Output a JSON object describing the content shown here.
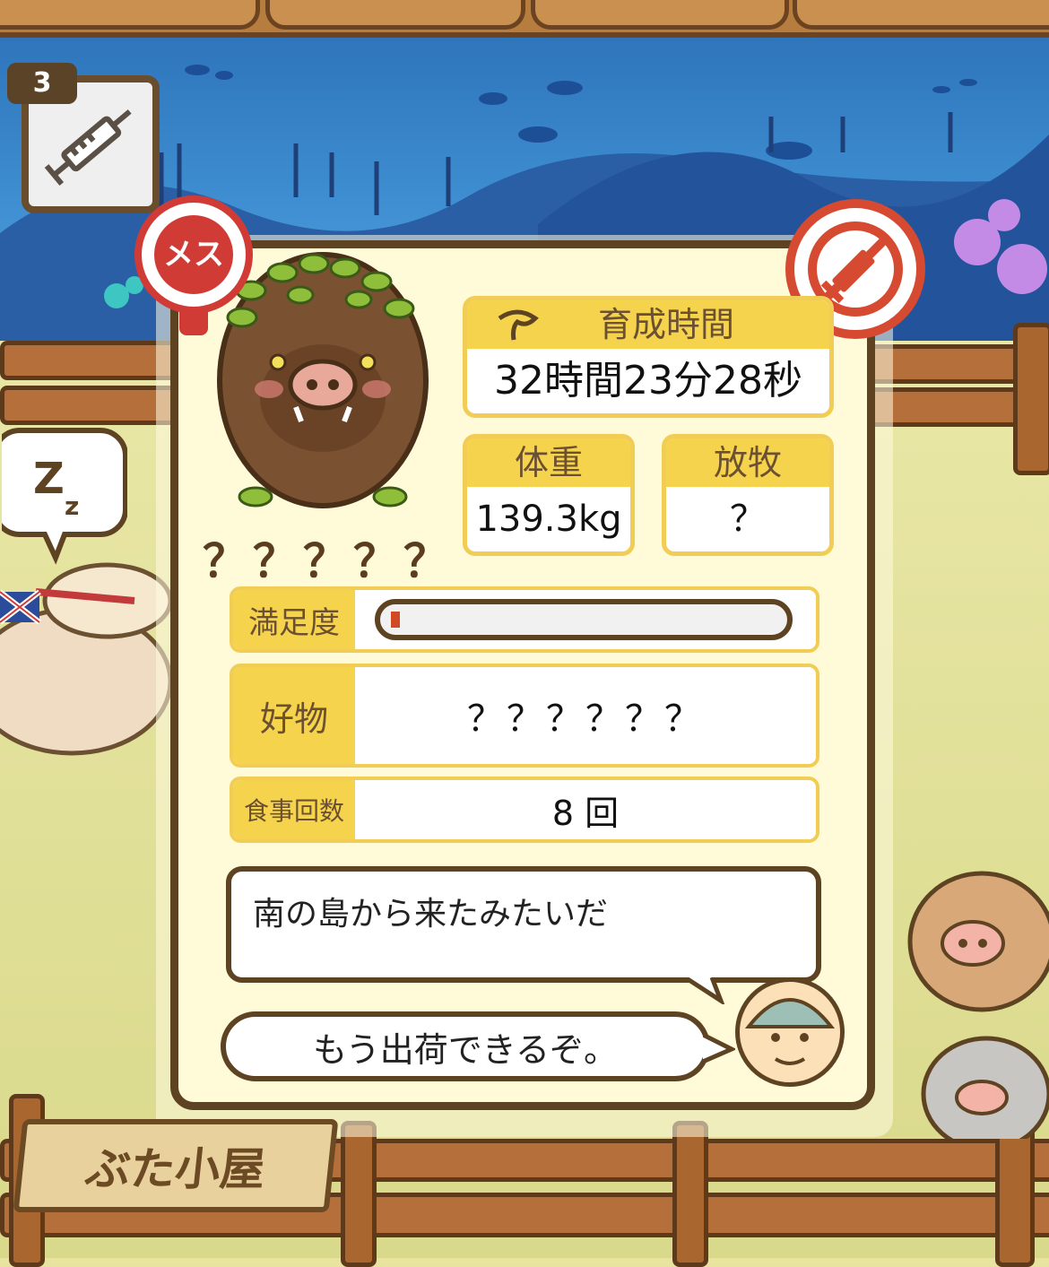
{
  "item": {
    "count": "3",
    "icon": "syringe-icon"
  },
  "pig": {
    "gender_label": "メス",
    "name": "？？？？？",
    "icon": "wild-boar-icon"
  },
  "stats": {
    "raising_time_label": "育成時間",
    "raising_time_value": "32時間23分28秒",
    "weight_label": "体重",
    "weight_value": "139.3kg",
    "grazing_label": "放牧",
    "grazing_value": "？"
  },
  "rows": {
    "satisfaction_label": "満足度",
    "satisfaction_level": 0.02,
    "favorite_label": "好物",
    "favorite_value": "？？？？？？",
    "meals_label": "食事回数",
    "meals_value": "8 回"
  },
  "messages": {
    "origin": "南の島から来たみたいだ",
    "ship": "もう出荷できるぞ。"
  },
  "sign": {
    "label": "ぶた小屋"
  },
  "colors": {
    "accent": "#f6d34d",
    "frame": "#5d4322",
    "female": "#d13b36",
    "bar": "#d14a23"
  }
}
